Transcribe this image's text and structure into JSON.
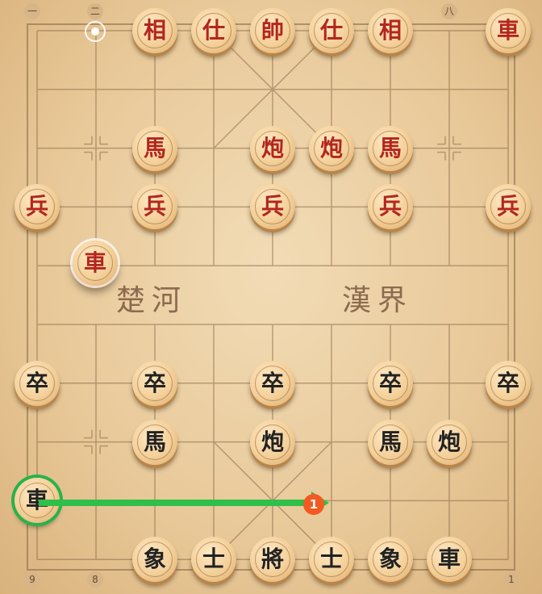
{
  "top_coords": [
    "一",
    "二",
    "八"
  ],
  "bottom_coords": [
    "9",
    "8",
    "1"
  ],
  "river": {
    "left": "楚河",
    "right": "漢界"
  },
  "move_badge": "1",
  "colors": {
    "red_text": "#b3261e",
    "black_text": "#222222",
    "arrow": "#2fbf4a",
    "badge": "#f25a22"
  },
  "pieces": {
    "red": [
      {
        "char": "相",
        "col": 2,
        "row": 0
      },
      {
        "char": "仕",
        "col": 3,
        "row": 0
      },
      {
        "char": "帥",
        "col": 4,
        "row": 0
      },
      {
        "char": "仕",
        "col": 5,
        "row": 0
      },
      {
        "char": "相",
        "col": 6,
        "row": 0
      },
      {
        "char": "車",
        "col": 8,
        "row": 0
      },
      {
        "char": "馬",
        "col": 2,
        "row": 2
      },
      {
        "char": "炮",
        "col": 4,
        "row": 2
      },
      {
        "char": "炮",
        "col": 5,
        "row": 2
      },
      {
        "char": "馬",
        "col": 6,
        "row": 2
      },
      {
        "char": "兵",
        "col": 0,
        "row": 3
      },
      {
        "char": "兵",
        "col": 2,
        "row": 3
      },
      {
        "char": "兵",
        "col": 4,
        "row": 3
      },
      {
        "char": "兵",
        "col": 6,
        "row": 3
      },
      {
        "char": "兵",
        "col": 8,
        "row": 3
      },
      {
        "char": "車",
        "col": 1,
        "row": 4,
        "state": "last-move"
      }
    ],
    "black": [
      {
        "char": "卒",
        "col": 0,
        "row": 6
      },
      {
        "char": "卒",
        "col": 2,
        "row": 6
      },
      {
        "char": "卒",
        "col": 4,
        "row": 6
      },
      {
        "char": "卒",
        "col": 6,
        "row": 6
      },
      {
        "char": "卒",
        "col": 8,
        "row": 6
      },
      {
        "char": "馬",
        "col": 2,
        "row": 7
      },
      {
        "char": "炮",
        "col": 4,
        "row": 7
      },
      {
        "char": "馬",
        "col": 6,
        "row": 7
      },
      {
        "char": "炮",
        "col": 7,
        "row": 7
      },
      {
        "char": "車",
        "col": 0,
        "row": 8,
        "state": "selected"
      },
      {
        "char": "象",
        "col": 2,
        "row": 9
      },
      {
        "char": "士",
        "col": 3,
        "row": 9
      },
      {
        "char": "將",
        "col": 4,
        "row": 9
      },
      {
        "char": "士",
        "col": 5,
        "row": 9
      },
      {
        "char": "象",
        "col": 6,
        "row": 9
      },
      {
        "char": "車",
        "col": 7,
        "row": 9
      }
    ]
  }
}
